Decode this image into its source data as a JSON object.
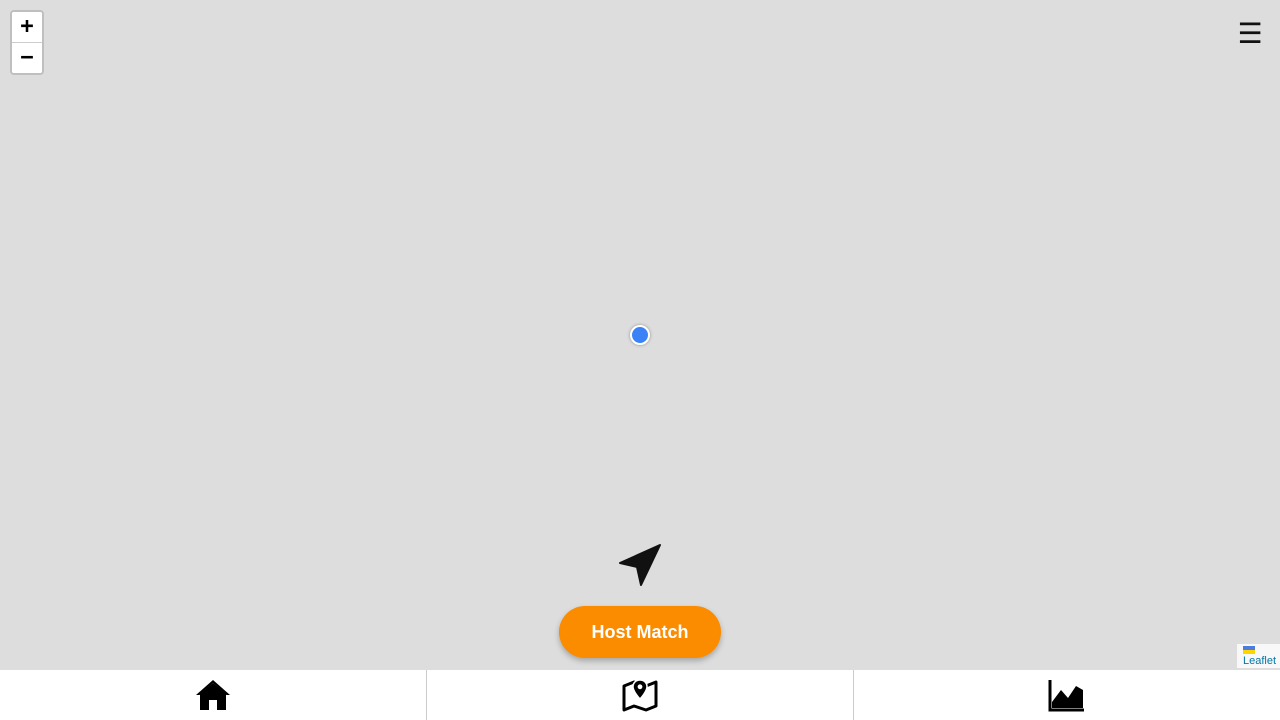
{
  "map": {
    "zoom_in_label": "+",
    "zoom_out_label": "−",
    "menu_icon": "☰",
    "user_location_icon": "location-dot-icon",
    "locate_icon": "navigation-arrow-icon",
    "attribution": {
      "flag_icon": "ukraine-flag-icon",
      "link_text": "Leaflet"
    }
  },
  "actions": {
    "host_match_label": "Host Match",
    "host_match_color": "#fb8c00"
  },
  "colors": {
    "map_background": "#dddddd",
    "location_dot": "#3b82f6"
  },
  "bottom_nav": {
    "items": [
      {
        "icon": "home-icon"
      },
      {
        "icon": "map-location-icon"
      },
      {
        "icon": "area-chart-icon"
      }
    ]
  }
}
